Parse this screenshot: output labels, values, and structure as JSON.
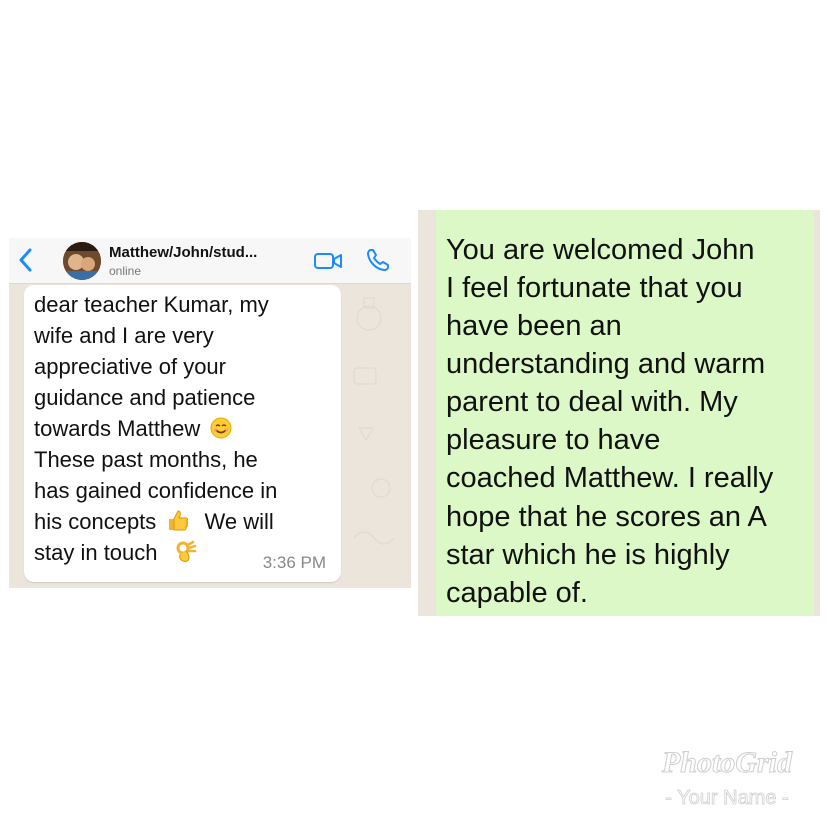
{
  "chat": {
    "contact_name": "Matthew/John/stud...",
    "status": "online",
    "message_lines": [
      "dear teacher Kumar, my",
      "wife and I are very",
      "appreciative of your",
      "guidance and patience",
      "towards Matthew",
      "These past months, he",
      "has gained confidence in",
      "his concepts",
      "We will",
      "stay in touch"
    ],
    "time": "3:36 PM"
  },
  "reply": {
    "lines": [
      "You are welcomed John",
      "I feel fortunate that you",
      "have been an",
      "understanding and warm",
      "parent to deal with. My",
      "pleasure to have",
      "coached Matthew. I really",
      "hope that he scores an A",
      "star which he is highly",
      "capable of."
    ]
  },
  "watermark": {
    "brand": "PhotoGrid",
    "subtitle": "- Your Name -"
  },
  "icons": {
    "back": "chevron-left-icon",
    "video": "video-camera-icon",
    "call": "phone-icon",
    "smile": "smiling-face-emoji",
    "thumbs_up": "thumbs-up-emoji",
    "ok_hand": "ok-hand-emoji"
  },
  "colors": {
    "ios_blue": "#1a8cff",
    "incoming_bubble": "#ffffff",
    "outgoing_bubble": "#dcf8c6",
    "chat_background": "#ebe5dc"
  }
}
